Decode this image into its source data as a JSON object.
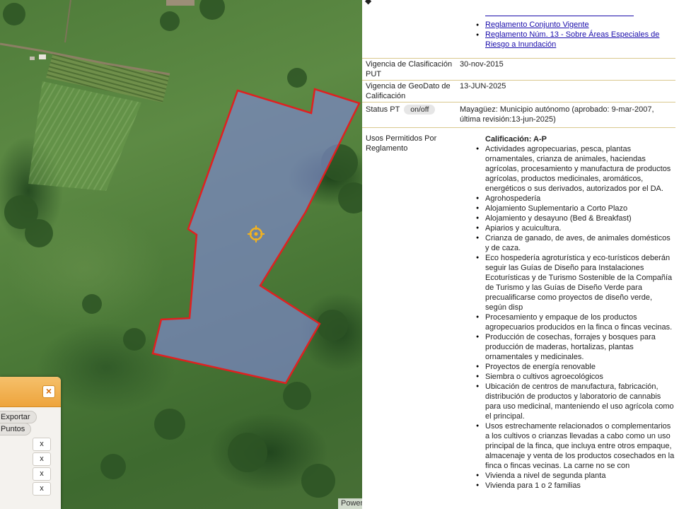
{
  "map": {
    "attribution": "Powered by Esri",
    "parcel_color": "#e02020",
    "marker_icon": "crosshair-target-icon"
  },
  "float_panel": {
    "close_label": "×",
    "pill1": "Exportar",
    "pill2": "Puntos",
    "remove_labels": [
      "x",
      "x",
      "x",
      "x"
    ]
  },
  "info": {
    "prev_links": [
      "Reglamento Conjunto Vigente",
      "Reglamento Núm. 13 - Sobre Áreas Especiales de Riesgo a Inundación"
    ],
    "rows": [
      {
        "label": "Vigencia de Clasificación PUT",
        "value": "30-nov-2015"
      },
      {
        "label": "Vigencia de GeoDato de Calificación",
        "value": "13-JUN-2025"
      },
      {
        "label": "Status PT",
        "toggle": "on/off",
        "value": "Mayagüez: Municipio autónomo (aprobado: 9-mar-2007, última revisión:13-jun-2025)"
      },
      {
        "label": "Usos Permitidos Por Reglamento"
      }
    ],
    "calificacion": "Calificación: A-P",
    "usos": [
      "Actividades agropecuarias, pesca, plantas ornamentales, crianza de animales, haciendas agrícolas, procesamiento y manufactura de productos agrícolas, productos medicinales, aromáticos, energéticos o sus derivados, autorizados por el DA.",
      "Agrohospedería",
      "Alojamiento Suplementario a Corto Plazo",
      "Alojamiento y desayuno (Bed & Breakfast)",
      "Apiarios y acuicultura.",
      "Crianza de ganado, de aves, de animales domésticos y de caza.",
      "Eco hospedería agroturística y eco-turísticos deberán seguir las Guías de Diseño para Instalaciones Ecoturísticas y de Turismo Sostenible de la Compañía de Turismo y las Guías de Diseño Verde para precualificarse como proyectos de diseño verde, según disp",
      "Procesamiento y empaque de los productos agropecuarios producidos en la finca o fincas vecinas.",
      "Producción de cosechas, forrajes y bosques para producción de maderas, hortalizas, plantas ornamentales y medicinales.",
      "Proyectos de energía renovable",
      "Siembra o cultivos agroecológicos",
      "Ubicación de centros de manufactura, fabricación, distribución de productos y laboratorio de cannabis para uso medicinal, manteniendo el uso agrícola como el principal.",
      "Usos estrechamente relacionados o complementarios a los cultivos o crianzas llevadas a cabo como un uso principal de la finca, que incluya entre otros empaque, almacenaje y venta de los productos cosechados en la finca o fincas vecinas. La carne no se con",
      "Vivienda a nivel de segunda planta",
      "Vivienda para 1 o 2 familias"
    ]
  }
}
